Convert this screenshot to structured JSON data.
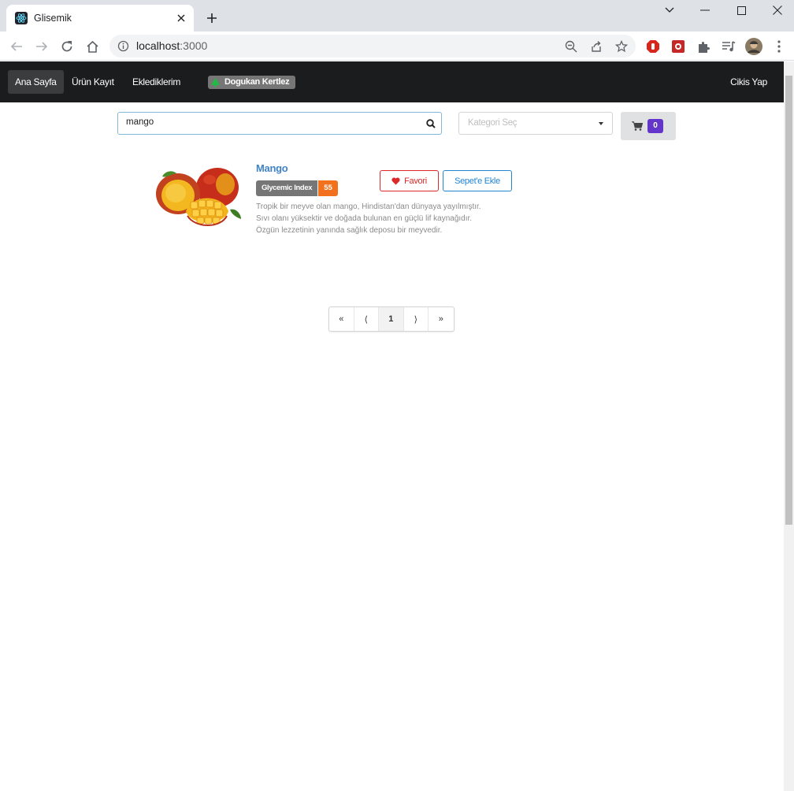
{
  "browser": {
    "tab_title": "Glisemik",
    "url_host": "localhost",
    "url_port": ":3000"
  },
  "nav": {
    "items": [
      {
        "label": "Ana Sayfa"
      },
      {
        "label": "Ürün Kayıt"
      },
      {
        "label": "Eklediklerim"
      }
    ],
    "user": "Dogukan Kertlez",
    "logout": "Cikis Yap"
  },
  "search": {
    "value": "mango",
    "category_placeholder": "Kategori Seç",
    "cart_count": "0"
  },
  "product": {
    "name": "Mango",
    "gi_label": "Glycemic Index",
    "gi_value": "55",
    "favorite_label": "Favori",
    "add_to_cart_label": "Sepet'e Ekle",
    "description_lines": [
      "Tropik bir meyve olan mango, Hindistan'dan dünyaya yayılmıştır.",
      "Sıvı olanı yüksektir ve doğada bulunan en güçlü lif kaynağıdır.",
      "Özgün lezzetinin yanında sağlık deposu bir meyvedir."
    ]
  },
  "pagination": {
    "first": "«",
    "prev": "⟨",
    "current": "1",
    "next": "⟩",
    "last": "»"
  },
  "colors": {
    "navbar": "#1b1c1d",
    "link": "#4183c4",
    "gi_value": "#f2711c",
    "favorite": "#db2828",
    "cart_button": "#2185d0",
    "cart_count": "#6435c9"
  },
  "icons": [
    "react-icon",
    "close-icon",
    "plus-icon",
    "back-icon",
    "forward-icon",
    "reload-icon",
    "home-icon",
    "info-icon",
    "zoom-icon",
    "share-icon",
    "star-icon",
    "extension-icon",
    "tree-icon",
    "search-icon",
    "cart-icon",
    "heart-icon"
  ]
}
